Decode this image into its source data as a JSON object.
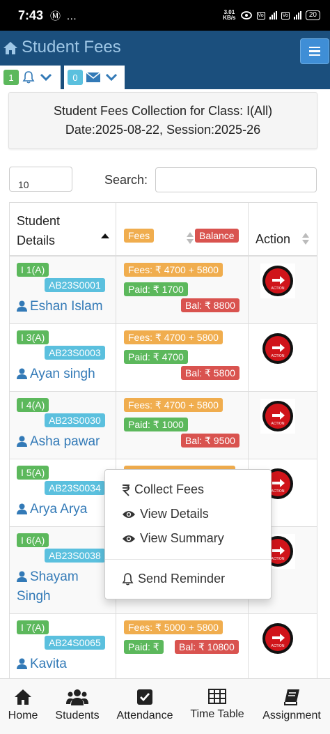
{
  "status_bar": {
    "time": "7:43",
    "left_icons": "Ⓜ …",
    "speed_top": "3.01",
    "speed_bottom": "KB/s",
    "battery": "20"
  },
  "header": {
    "title": "Student Fees",
    "notifications_count": "1",
    "messages_count": "0"
  },
  "panel": {
    "line1": "Student Fees Collection for Class: I(All)",
    "line2": "Date:2025-08-22, Session:2025-26"
  },
  "controls": {
    "page_length": "10",
    "search_label": "Search:"
  },
  "table": {
    "headers": {
      "student": "Student",
      "details": "Details",
      "fees": "Fees",
      "balance": "Balance",
      "action": "Action"
    },
    "rows": [
      {
        "roll": "I 1(A)",
        "id": "AB23S0001",
        "name": "Eshan Islam",
        "fees": "Fees: ₹ 4700 + 5800",
        "paid": "Paid: ₹ 1700",
        "bal": "Bal: ₹ 8800"
      },
      {
        "roll": "I 3(A)",
        "id": "AB23S0003",
        "name": "Ayan singh",
        "fees": "Fees: ₹ 4700 + 5800",
        "paid": "Paid: ₹ 4700",
        "bal": "Bal: ₹ 5800"
      },
      {
        "roll": "I 4(A)",
        "id": "AB23S0030",
        "name": "Asha pawar",
        "fees": "Fees: ₹ 4700 + 5800",
        "paid": "Paid: ₹ 1000",
        "bal": "Bal: ₹ 9500"
      },
      {
        "roll": "I 5(A)",
        "id": "AB23S0034",
        "name": "Arya Arya"
      },
      {
        "roll": "I 6(A)",
        "id": "AB23S0038",
        "name_line1": "Shayam",
        "name_line2": "Singh"
      },
      {
        "roll": "I 7(A)",
        "id": "AB24S0065",
        "name": "Kavita",
        "fees": "Fees: ₹ 5000 + 5800",
        "paid": "Paid: ₹",
        "bal": "Bal: ₹ 10800"
      }
    ],
    "action_label": "ACTION"
  },
  "dropdown": {
    "collect": "Collect Fees",
    "details": "View Details",
    "summary": "View Summary",
    "reminder": "Send Reminder"
  },
  "bottom_nav": {
    "home": "Home",
    "students": "Students",
    "attendance": "Attendance",
    "timetable": "Time Table",
    "assignment": "Assignment"
  },
  "colors": {
    "header": "#1b4f7d",
    "success": "#5cb85c",
    "info": "#5bc0de",
    "warning": "#f0ad4e",
    "danger": "#d9534f",
    "link": "#337ab7"
  }
}
